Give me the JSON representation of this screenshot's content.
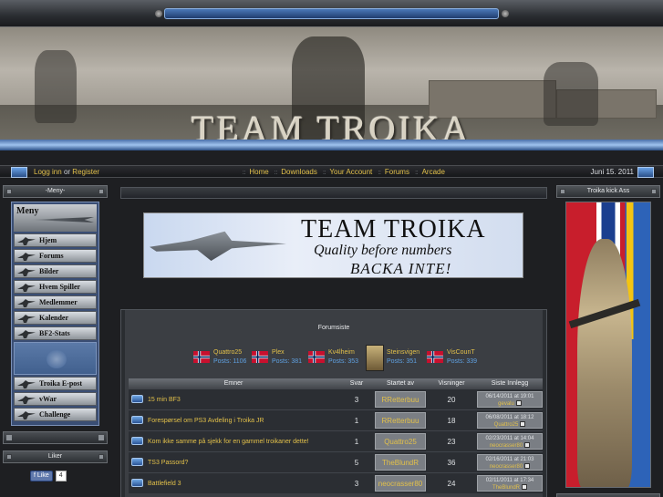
{
  "header": {
    "site_title": "TEAM TROIKA"
  },
  "navbar": {
    "login_label": "Logg inn",
    "or_label": "or",
    "register_label": "Register",
    "links": [
      "Home",
      "Downloads",
      "Your Account",
      "Forums",
      "Arcade"
    ],
    "separator": "::",
    "date": "Juni 15. 2011"
  },
  "left_menu": {
    "header": "-Meny-",
    "title": "Meny",
    "items": [
      "Hjem",
      "Forums",
      "Bilder",
      "Hvem Spiller",
      "Medlemmer",
      "Kalender",
      "BF2-Stats"
    ],
    "items_after_logo": [
      "Troika E-post",
      "vWar",
      "Challenge"
    ]
  },
  "likes_panel": {
    "header": "Liker",
    "button_label": "Like",
    "count": "4"
  },
  "center_banner": {
    "title": "TEAM TROIKA",
    "subtitle": "Quality before numbers",
    "tagline": "BACKA INTE!"
  },
  "forum": {
    "title": "Forumsiste",
    "top_posters": [
      {
        "name": "Quattro25",
        "posts": "Posts: 1106",
        "flag": "norway"
      },
      {
        "name": "Plex",
        "posts": "Posts: 381",
        "flag": "norway"
      },
      {
        "name": "Kv4lheim",
        "posts": "Posts: 353",
        "flag": "norway"
      },
      {
        "name": "Steinsvigen",
        "posts": "Posts: 351",
        "flag": "avatar"
      },
      {
        "name": "VisCounT",
        "posts": "Posts: 339",
        "flag": "norway"
      }
    ],
    "columns": [
      "Emner",
      "Svar",
      "Startet av",
      "Visninger",
      "Siste Innlegg"
    ],
    "topics": [
      {
        "title": "15 min BF3",
        "replies": "3",
        "starter": "RRetterbuu",
        "views": "20",
        "last_date": "06/14/2011 at 19:01",
        "last_user": "gevalu"
      },
      {
        "title": "Forespørsel om PS3 Avdeling i Troika JR",
        "replies": "1",
        "starter": "RRetterbuu",
        "views": "18",
        "last_date": "06/08/2011 at 18:12",
        "last_user": "Quattro25"
      },
      {
        "title": "Kom ikke samme på sjekk for en gammel troikaner dette!",
        "replies": "1",
        "starter": "Quattro25",
        "views": "23",
        "last_date": "02/23/2011 at 14:04",
        "last_user": "neocrasser80"
      },
      {
        "title": "TS3 Passord?",
        "replies": "5",
        "starter": "TheBlundR",
        "views": "36",
        "last_date": "02/16/2011 at 21:03",
        "last_user": "neocrasser80"
      },
      {
        "title": "Battlefield 3",
        "replies": "3",
        "starter": "neocrasser80",
        "views": "24",
        "last_date": "02/11/2011 at 17:34",
        "last_user": "TheBlundR"
      }
    ]
  },
  "right_panel": {
    "header": "Troika kick Ass"
  },
  "colors": {
    "link_gold": "#e2c04a",
    "post_blue": "#5fa0e0",
    "menu_blue": "#3a4e74"
  }
}
